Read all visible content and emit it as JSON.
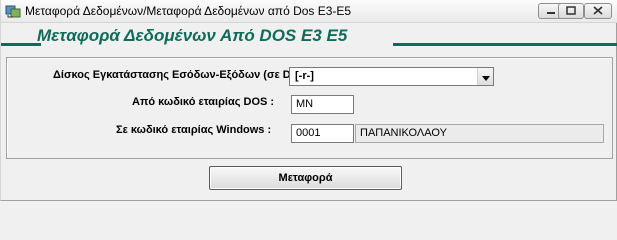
{
  "window": {
    "title": "Μεταφορά Δεδομένων/Μεταφορά Δεδομένων από Dos E3-E5",
    "icon": "app-icon",
    "controls": [
      "minimize-icon",
      "maximize-icon",
      "close-icon"
    ]
  },
  "header": {
    "text": "Μεταφορά Δεδομένων Από DOS E3 E5",
    "color": "#0f6b5a"
  },
  "form": {
    "disk_label": "Δίσκος Εγκατάστασης Εσόδων-Εξόδων (σε DOS) :",
    "disk_value": "[-r-]",
    "dos_company_label": "Από κωδικό εταιρίας DOS :",
    "dos_company_value": "MN",
    "win_company_label": "Σε κωδικό εταιρίας Windows :",
    "win_company_code": "0001",
    "win_company_name": "ΠΑΠΑΝΙΚΟΛΑΟΥ"
  },
  "actions": {
    "transfer_label": "Μεταφορά"
  }
}
